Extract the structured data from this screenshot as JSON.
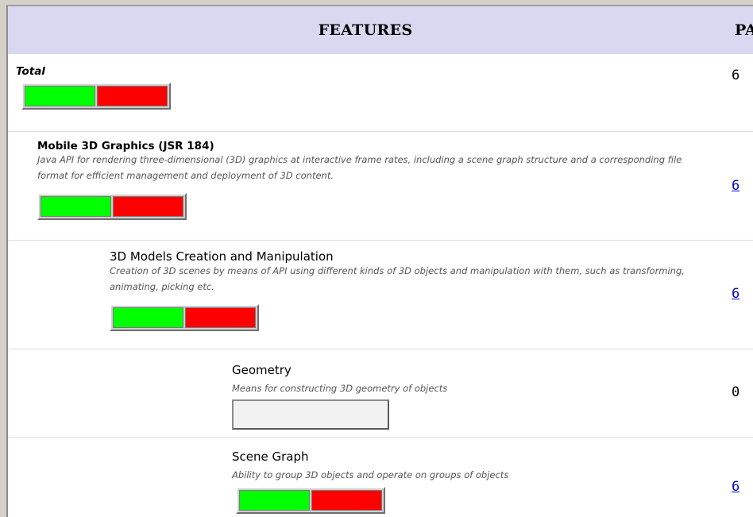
{
  "header": {
    "features": "FEATURES",
    "pa": "PA"
  },
  "colors": {
    "pass": "#00ff00",
    "fail": "#ff0000",
    "header_bg": "#d8d8f0",
    "link": "#0000cc"
  },
  "rows": [
    {
      "title": "Total",
      "description": "",
      "count": "6",
      "count_link": false,
      "pass_fraction": 0.5
    },
    {
      "title": "Mobile 3D Graphics (JSR 184)",
      "description": "Java API for rendering three-dimensional (3D) graphics at interactive frame rates, including a scene graph structure and a corresponding file format for efficient management and deployment of 3D content.",
      "count": "6",
      "count_link": true,
      "pass_fraction": 0.5
    },
    {
      "title": "3D Models Creation and Manipulation",
      "description": "Creation of 3D scenes by means of API using different kinds of 3D objects and manipulation with them, such as transforming, animating, picking etc.",
      "count": "6",
      "count_link": true,
      "pass_fraction": 0.5
    },
    {
      "title": "Geometry",
      "description": "Means for constructing 3D geometry of objects",
      "count": "0",
      "count_link": false,
      "pass_fraction": null
    },
    {
      "title": "Scene Graph",
      "description": "Ability to group 3D objects and operate on groups of objects",
      "count": "6",
      "count_link": true,
      "pass_fraction": 0.5
    }
  ]
}
